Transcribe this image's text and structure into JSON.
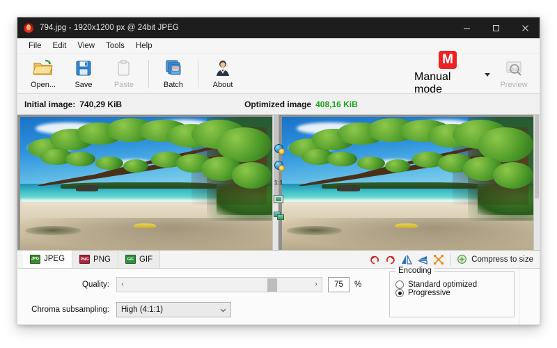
{
  "window": {
    "title": "794.jpg - 1920x1200 px @ 24bit JPEG",
    "app_icon": "flame-icon",
    "minimize": "minimize-icon",
    "maximize": "maximize-icon",
    "close": "close-icon"
  },
  "menu": {
    "items": [
      {
        "label": "File"
      },
      {
        "label": "Edit"
      },
      {
        "label": "View"
      },
      {
        "label": "Tools"
      },
      {
        "label": "Help"
      }
    ]
  },
  "toolbar": {
    "buttons": [
      {
        "label": "Open...",
        "icon": "open-folder-icon",
        "enabled": true
      },
      {
        "label": "Save",
        "icon": "floppy-disk-icon",
        "enabled": true
      },
      {
        "label": "Paste",
        "icon": "clipboard-paste-icon",
        "enabled": false
      },
      {
        "label": "Batch",
        "icon": "batch-stack-icon",
        "enabled": true
      },
      {
        "label": "About",
        "icon": "person-icon",
        "enabled": true
      }
    ],
    "mode": {
      "label": "Manual mode",
      "badge": "M",
      "badge_color": "#ee2222",
      "caret": "chevron-down-icon"
    },
    "preview": {
      "label": "Preview",
      "icon": "preview-magnifier-icon",
      "enabled": false
    }
  },
  "infobar": {
    "initial_label": "Initial image:",
    "initial_value": "740,29 KiB",
    "optimized_label": "Optimized image",
    "optimized_value": "408,16 KiB",
    "optimized_color": "#17a417"
  },
  "zoom_strip": {
    "buttons": [
      {
        "name": "zoom-in-icon"
      },
      {
        "name": "zoom-out-icon"
      },
      {
        "label": "1:1",
        "name": "actual-size-button"
      },
      {
        "name": "fit-to-window-icon"
      },
      {
        "name": "compare-view-icon"
      }
    ],
    "one_to_one": "1:1"
  },
  "format_tabs": [
    {
      "label": "JPEG",
      "icon": "jpeg-icon",
      "badge": "JPG",
      "color": "#3f8b2f",
      "active": true
    },
    {
      "label": "PNG",
      "icon": "png-icon",
      "badge": "PNG",
      "color": "#a8243a",
      "active": false
    },
    {
      "label": "GIF",
      "icon": "gif-icon",
      "badge": "GIF",
      "color": "#2f8f3f",
      "active": false
    }
  ],
  "tools": {
    "rotate_left": "rotate-left-icon",
    "rotate_right": "rotate-right-icon",
    "flip_horizontal": "flip-horizontal-icon",
    "flip_vertical": "flip-vertical-icon",
    "crop_resize": "resize-icon",
    "compress_to_size": {
      "label": "Compress to size",
      "icon": "compress-icon"
    }
  },
  "settings": {
    "quality": {
      "label": "Quality:",
      "value": "75",
      "unit": "%",
      "min": 0,
      "max": 100,
      "left_arrow": "‹",
      "right_arrow": "›"
    },
    "chroma": {
      "label": "Chroma subsampling:",
      "value": "High (4:1:1)",
      "caret": "chevron-down-icon"
    },
    "encoding": {
      "title": "Encoding",
      "options": [
        {
          "label": "Standard optimized",
          "selected": false
        },
        {
          "label": "Progressive",
          "selected": true
        }
      ]
    }
  },
  "images": {
    "left_panel": "original-image-preview",
    "right_panel": "optimized-image-preview",
    "subject": "tropical beach with overhanging tree"
  }
}
